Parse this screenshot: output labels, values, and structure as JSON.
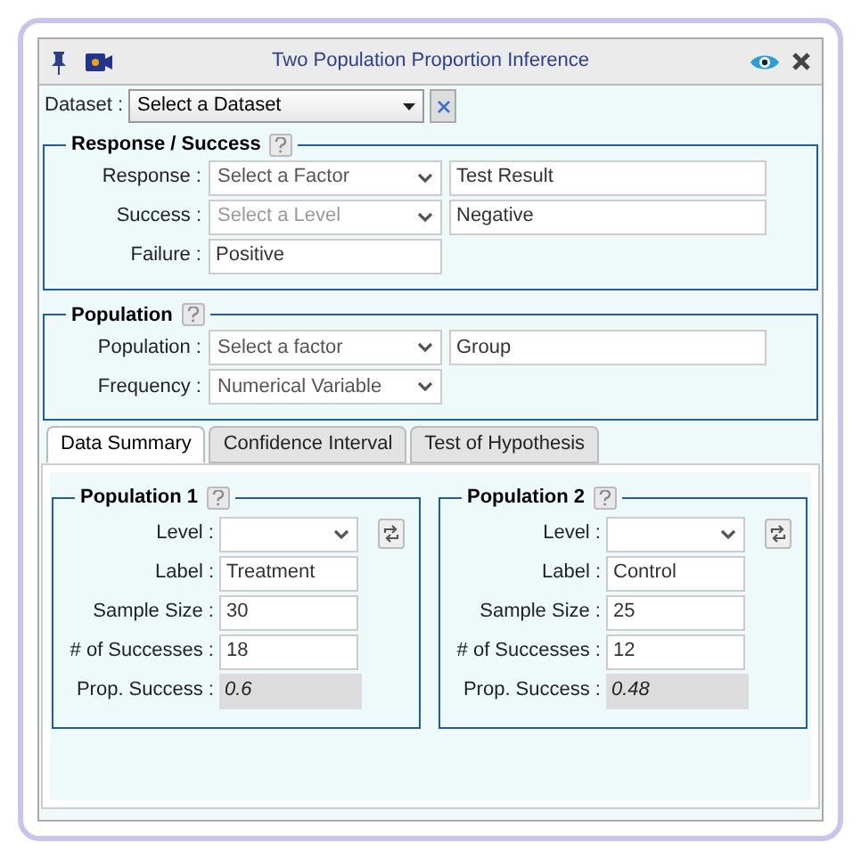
{
  "window": {
    "title": "Two Population Proportion Inference"
  },
  "dataset": {
    "label": "Dataset :",
    "value": "Select a Dataset"
  },
  "sections": [
    {
      "title": "Response / Success",
      "rows": [
        {
          "label": "Response :",
          "select": "Select a Factor",
          "disabled": false,
          "value": "Test Result"
        },
        {
          "label": "Success :",
          "select": "Select a Level",
          "disabled": true,
          "value": "Negative"
        },
        {
          "label": "Failure :",
          "value": "Positive"
        }
      ]
    },
    {
      "title": "Population",
      "rows": [
        {
          "label": "Population :",
          "select": "Select a factor",
          "disabled": false,
          "value": "Group"
        },
        {
          "label": "Frequency :",
          "select": "Numerical Variable",
          "disabled": false
        }
      ]
    }
  ],
  "tabs": [
    {
      "label": "Data Summary",
      "selected": true
    },
    {
      "label": "Confidence Interval",
      "selected": false
    },
    {
      "label": "Test of Hypothesis",
      "selected": false
    }
  ],
  "populations": [
    {
      "title": "Population 1",
      "fields": [
        {
          "kind": "select",
          "label": "Level :"
        },
        {
          "kind": "input",
          "label": "Label :",
          "value": "Treatment"
        },
        {
          "kind": "input",
          "label": "Sample Size :",
          "value": "30"
        },
        {
          "kind": "input",
          "label": "# of Successes :",
          "value": "18"
        },
        {
          "kind": "readonly",
          "label": "Prop. Success :",
          "value": "0.6"
        }
      ]
    },
    {
      "title": "Population 2",
      "fields": [
        {
          "kind": "select",
          "label": "Level :"
        },
        {
          "kind": "input",
          "label": "Label :",
          "value": "Control"
        },
        {
          "kind": "input",
          "label": "Sample Size :",
          "value": "25"
        },
        {
          "kind": "input",
          "label": "# of Successes :",
          "value": "12"
        },
        {
          "kind": "readonly",
          "label": "Prop. Success :",
          "value": "0.48"
        }
      ]
    }
  ]
}
